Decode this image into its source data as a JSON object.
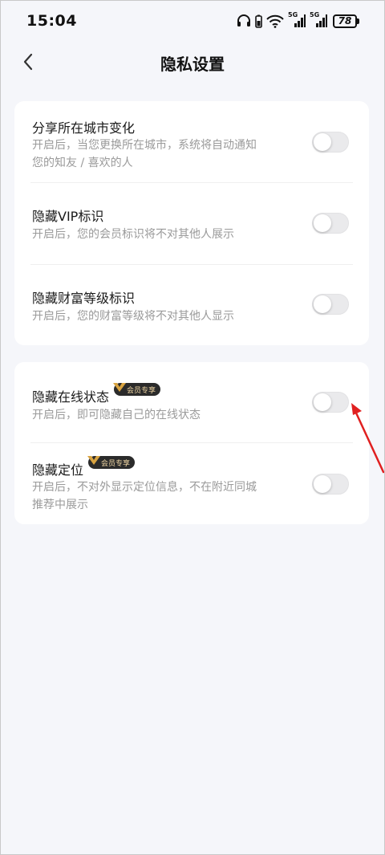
{
  "status_bar": {
    "time": "15:04",
    "network_tag_1": "5G",
    "network_tag_2": "5G",
    "battery": "78"
  },
  "nav": {
    "back_icon": "chevron-left-icon",
    "title": "隐私设置"
  },
  "card1": {
    "items": [
      {
        "title": "分享所在城市变化",
        "desc_line1": "开启后，当您更换所在城市，系统将自动通知",
        "desc_line2": "您的知友 / 喜欢的人",
        "enabled": false
      },
      {
        "title": "隐藏VIP标识",
        "desc_line1": "开启后，您的会员标识将不对其他人展示",
        "enabled": false
      },
      {
        "title": "隐藏财富等级标识",
        "desc_line1": "开启后，您的财富等级将不对其他人显示",
        "enabled": false
      }
    ]
  },
  "card2": {
    "items": [
      {
        "title": "隐藏在线状态",
        "badge": "会员专享",
        "desc_line1": "开启后，即可隐藏自己的在线状态",
        "enabled": false
      },
      {
        "title": "隐藏定位",
        "badge": "会员专享",
        "desc_line1": "开启后，不对外显示定位信息，不在附近同城",
        "desc_line2": "推荐中展示",
        "enabled": false
      }
    ]
  },
  "colors": {
    "background": "#f5f6fa",
    "card": "#ffffff",
    "desc_text": "#9a9a9a",
    "toggle_off": "#eaeaec",
    "badge_bg": "#2b2b2b",
    "badge_text": "#f1d7a5",
    "annotation_arrow": "#e02020"
  }
}
